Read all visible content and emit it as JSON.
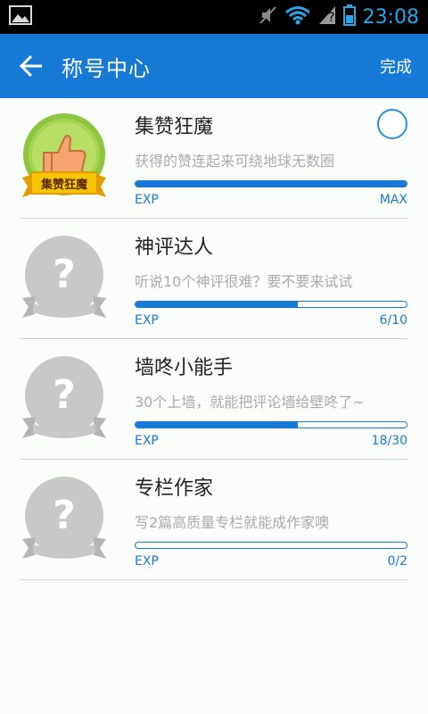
{
  "status_bar": {
    "time": "23:08",
    "icons": [
      "image-icon",
      "mute-icon",
      "wifi-icon",
      "signal-unknown-icon",
      "battery-icon"
    ]
  },
  "header": {
    "title": "称号中心",
    "done_label": "完成",
    "background_color": "#1679d6"
  },
  "titles": [
    {
      "name": "集赞狂魔",
      "description": "获得的赞连起来可绕地球无数圈",
      "exp_label": "EXP",
      "progress_text": "MAX",
      "progress": 1.0,
      "unlocked": true,
      "badge_text": "集赞狂魔"
    },
    {
      "name": "神评达人",
      "description": "听说10个神评很难？要不要来试试",
      "exp_label": "EXP",
      "progress_text": "6/10",
      "progress": 0.6,
      "unlocked": false
    },
    {
      "name": "墙咚小能手",
      "description": "30个上墙，就能把评论墙给壁咚了~",
      "exp_label": "EXP",
      "progress_text": "18/30",
      "progress": 0.6,
      "unlocked": false
    },
    {
      "name": "专栏作家",
      "description": "写2篇高质量专栏就能成作家噢",
      "exp_label": "EXP",
      "progress_text": "0/2",
      "progress": 0.0,
      "unlocked": false
    }
  ]
}
